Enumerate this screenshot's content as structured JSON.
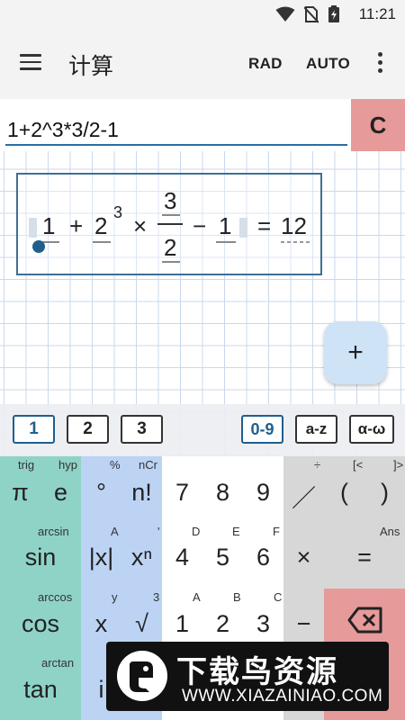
{
  "status": {
    "time": "11:21",
    "icons": [
      "wifi-icon",
      "no-sim-icon",
      "battery-charging-icon"
    ]
  },
  "appbar": {
    "title": "计算",
    "rad_label": "RAD",
    "auto_label": "AUTO"
  },
  "input": {
    "value": "1+2^3*3/2-1",
    "clear_label": "C"
  },
  "formula": {
    "t1": "1",
    "plus": "+",
    "base": "2",
    "exp": "3",
    "times": "×",
    "num": "3",
    "den": "2",
    "minus": "−",
    "t5": "1",
    "eq": "=",
    "result": "12"
  },
  "fab_label": "+",
  "tabs": {
    "t1": "1",
    "t2": "2",
    "t3": "3",
    "digits": "0-9",
    "letters": "a-z",
    "greek": "α-ω"
  },
  "keys": {
    "pi": "π",
    "e": "e",
    "deg": "°",
    "fact": "n!",
    "k7": "7",
    "k8": "8",
    "k9": "9",
    "div": "／",
    "lpar": "(",
    "rpar": ")",
    "sin": "sin",
    "abs": "|x|",
    "pow": "xⁿ",
    "k4": "4",
    "k5": "5",
    "k6": "6",
    "mul": "×",
    "eq": "=",
    "cos": "cos",
    "x": "x",
    "sqrt": "√",
    "k1": "1",
    "k2": "2",
    "k3": "3",
    "minus": "−",
    "tan": "tan",
    "i": "i",
    "sub_trig": "trig",
    "sub_hyp": "hyp",
    "sub_pct": "%",
    "sub_ncr": "nCr",
    "sub_div": "÷",
    "sub_lb": "[<",
    "sub_rb": "]>",
    "sub_arcsin": "arcsin",
    "sub_A1": "A",
    "sub_quote": "'",
    "sub_D": "D",
    "sub_E": "E",
    "sub_F": "F",
    "sub_ans": "Ans",
    "sub_arccos": "arccos",
    "sub_y": "y",
    "sub_3": "3",
    "sub_A2": "A",
    "sub_B": "B",
    "sub_C": "C",
    "sub_arctan": "arctan"
  },
  "watermark": {
    "title": "下载鸟资源",
    "url": "WWW.XIAZAINIAO.COM"
  },
  "colors": {
    "green": "#8fd3c7",
    "blue": "#bcd3f4",
    "gray": "#d7d7d7",
    "red": "#e79a9a",
    "accent": "#1f5f8e"
  }
}
